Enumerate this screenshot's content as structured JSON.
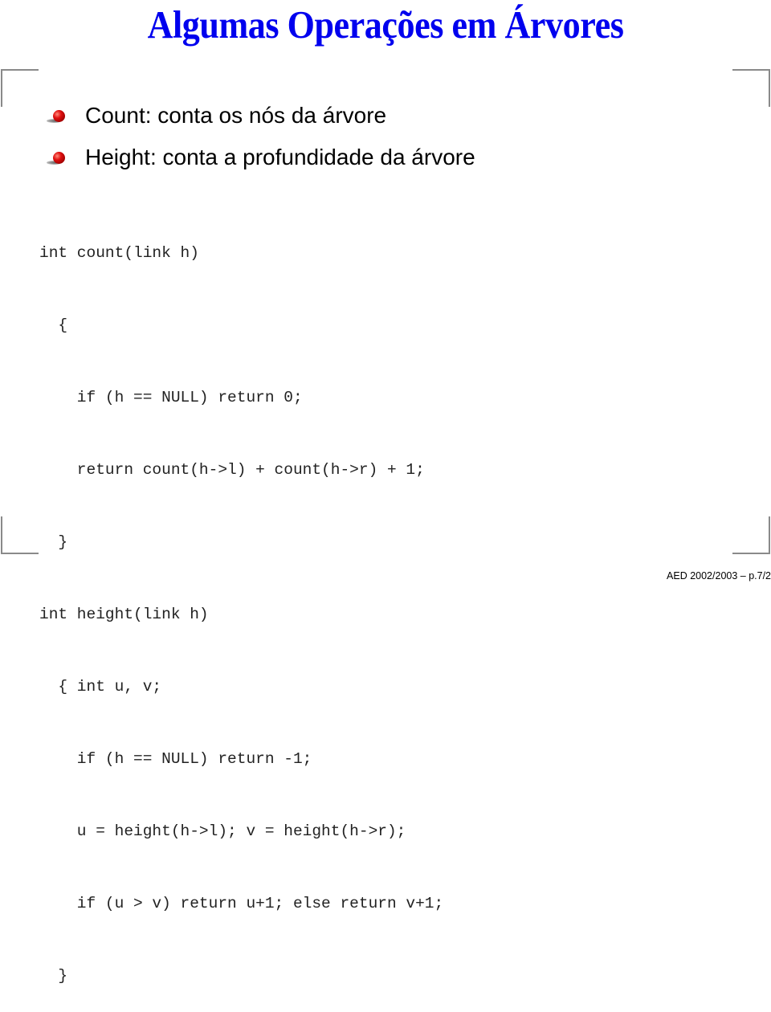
{
  "slide": {
    "title": "Algumas Operações em Árvores",
    "bullets": [
      {
        "icon": "red-ball-bullet-icon",
        "text": "Count: conta os nós da árvore"
      },
      {
        "icon": "red-ball-bullet-icon",
        "text": "Height: conta a profundidade da árvore"
      }
    ],
    "code_lines": [
      "int count(link h)",
      "  {",
      "    if (h == NULL) return 0;",
      "    return count(h->l) + count(h->r) + 1;",
      "  }",
      "int height(link h)",
      "  { int u, v;",
      "    if (h == NULL) return -1;",
      "    u = height(h->l); v = height(h->r);",
      "    if (u > v) return u+1; else return v+1;",
      "  }"
    ],
    "footer": "AED 2002/2003 – p.7/2",
    "colors": {
      "title": "#0000ee",
      "bullet": "#e01010",
      "frame": "#8a8a8a"
    }
  }
}
